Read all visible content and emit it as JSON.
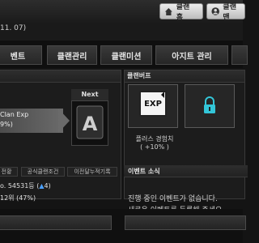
{
  "top_buttons": {
    "clan_home": "클랜 홈",
    "clan_mode": "클랜맨"
  },
  "date_text": "11. 07)",
  "tabs": [
    "벤트",
    "클랜관리",
    "클랜미션",
    "아지트 관리"
  ],
  "left_panel": {
    "next_label": "Next",
    "clan_exp_line1": "Clan Exp",
    "clan_exp_line2": "9%)",
    "lower_tabs": [
      "전황",
      "공식클랜조건",
      "이전달누적기록"
    ],
    "rank_text": "o. 54531등 (",
    "rank_delta": "4",
    "rank_suffix": ")",
    "percent_text": "12위 (47%)"
  },
  "right_panel": {
    "title": "클랜버프",
    "buff1_caption_line1": "플러스 경험치",
    "buff1_caption_line2": "( +10% )",
    "buff1_icon_text": "EXP"
  },
  "event_news": {
    "title": "이벤트 소식",
    "line1": "진행 중인 이벤트가 없습니다.",
    "line2": "새로운 이벤트를 등록해 주세요."
  },
  "colors": {
    "accent_blue": "#4aa0ff",
    "background": "#141414"
  }
}
